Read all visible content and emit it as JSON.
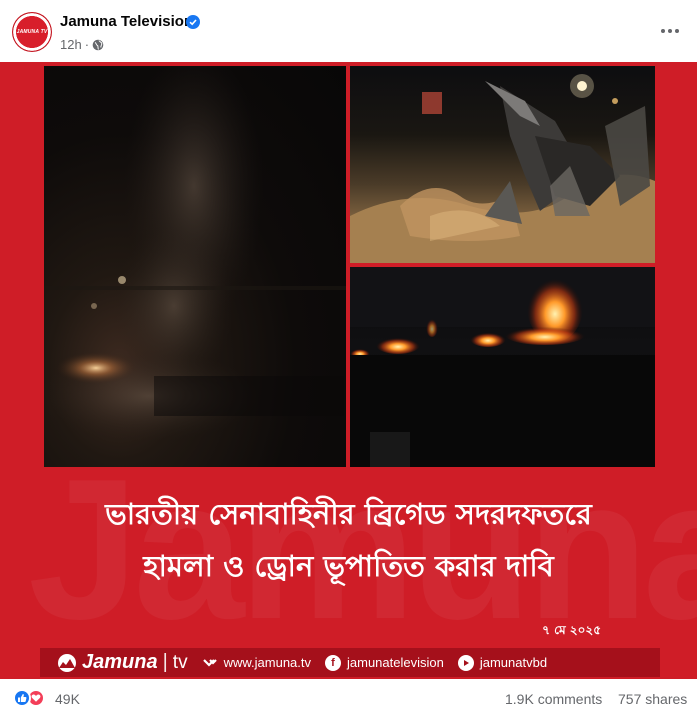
{
  "post": {
    "page_name": "Jamuna Television",
    "avatar_text": "JAMUNA TV",
    "time_ago": "12h",
    "separator": "·"
  },
  "image": {
    "headline_line1": "ভারতীয় সেনাবাহিনীর ব্রিগেড সদরদফতরে",
    "headline_line2": "হামলা ও ড্রোন ভূপাতিত করার দাবি",
    "date": "৭ মে ২০২৫",
    "watermark": "Jamuna",
    "brand_name": "Jamuna",
    "brand_sep": "|",
    "brand_suffix": "tv",
    "website": "www.jamuna.tv",
    "facebook_handle": "jamunatelevision",
    "youtube_handle": "jamunatvbd"
  },
  "reactions": {
    "count": "49K",
    "comments": "1.9K comments",
    "shares": "757 shares"
  },
  "colors": {
    "brand_red": "#cf1d27",
    "footer_red": "#a5101b",
    "like_blue": "#1877f2",
    "love_red": "#f33e58"
  },
  "icons": [
    "verified-badge-icon",
    "globe-icon",
    "more-options-icon",
    "globe-www-icon",
    "facebook-icon",
    "youtube-icon",
    "like-reaction-icon",
    "love-reaction-icon"
  ]
}
